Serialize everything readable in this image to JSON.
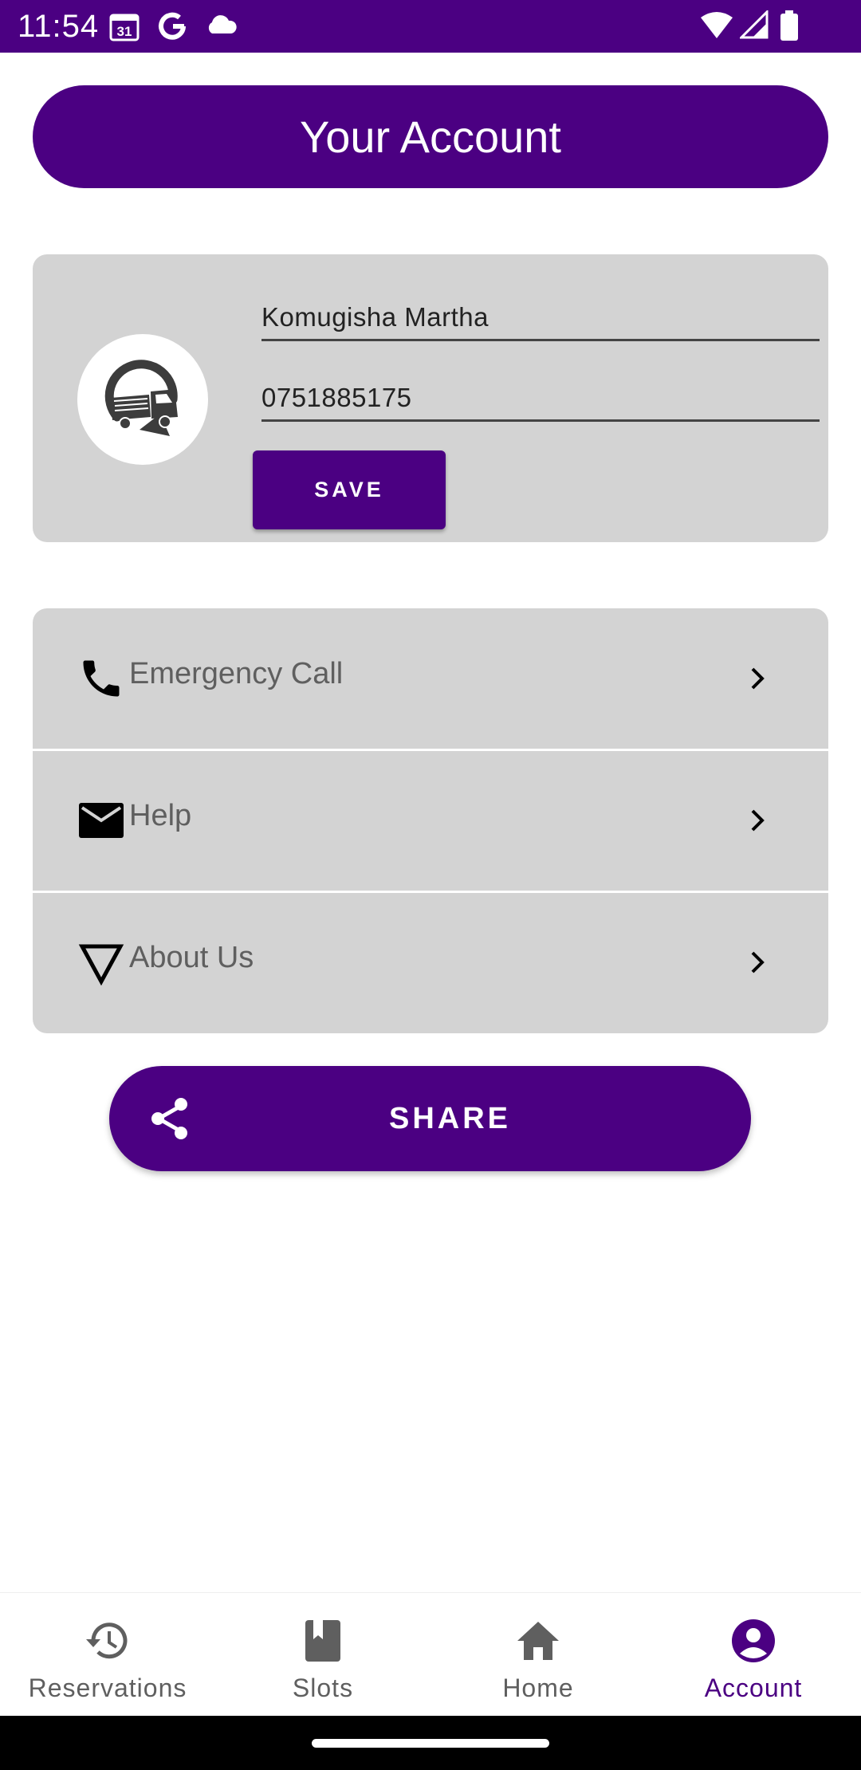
{
  "colors": {
    "primary": "#4b0082",
    "card_background": "#d3d3d3",
    "muted_text": "#5f5f5f"
  },
  "status_bar": {
    "time": "11:54",
    "calendar_day": "31",
    "icons": [
      "calendar-icon",
      "google-icon",
      "cloud-icon",
      "wifi-icon",
      "signal-icon",
      "battery-icon"
    ]
  },
  "header": {
    "title": "Your Account"
  },
  "profile": {
    "avatar_icon": "truck-logo-icon",
    "name_value": "Komugisha Martha",
    "phone_value": "0751885175",
    "save_label": "SAVE"
  },
  "menu": {
    "items": [
      {
        "label": "Emergency Call",
        "icon": "phone-icon"
      },
      {
        "label": "Help",
        "icon": "mail-icon"
      },
      {
        "label": "About Us",
        "icon": "triangle-down-icon"
      }
    ]
  },
  "share": {
    "label": "SHARE",
    "icon": "share-icon"
  },
  "bottom_nav": {
    "active": "Account",
    "items": [
      {
        "label": "Reservations",
        "icon": "history-icon"
      },
      {
        "label": "Slots",
        "icon": "book-icon"
      },
      {
        "label": "Home",
        "icon": "home-icon"
      },
      {
        "label": "Account",
        "icon": "account-circle-icon"
      }
    ]
  }
}
